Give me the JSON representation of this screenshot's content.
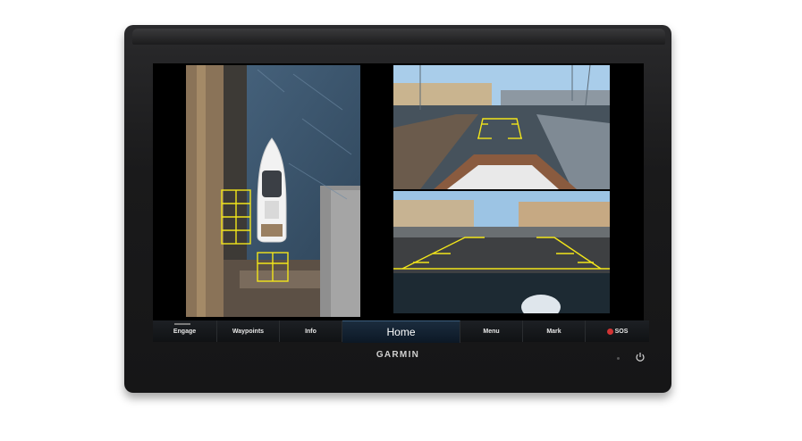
{
  "device": {
    "brand": "GARMIN"
  },
  "softkeys": [
    {
      "label": "Engage"
    },
    {
      "label": "Waypoints"
    },
    {
      "label": "Info"
    },
    {
      "label": "Home"
    },
    {
      "label": "Menu"
    },
    {
      "label": "Mark"
    },
    {
      "label": "SOS"
    }
  ],
  "icons": {
    "sos": "sos-icon",
    "power": "power-icon"
  },
  "colors": {
    "guide_lines": "#f2e51a",
    "home_key": "#1b2c3e",
    "bezel": "#1a1a1b"
  }
}
